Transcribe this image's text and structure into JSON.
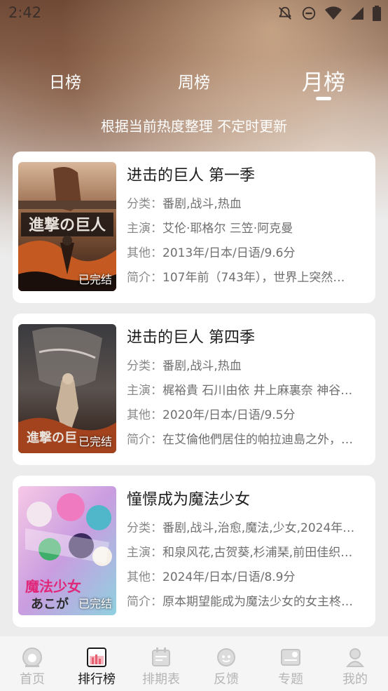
{
  "status_bar": {
    "time": "2:42"
  },
  "tabs": [
    {
      "label": "日榜",
      "active": false
    },
    {
      "label": "周榜",
      "active": false
    },
    {
      "label": "月榜",
      "active": true
    }
  ],
  "subtitle": "根据当前热度整理 不定时更新",
  "cards": [
    {
      "title": "进击的巨人 第一季",
      "category_label": "分类：",
      "category": "番剧,战斗,热血",
      "cast_label": "主演：",
      "cast": "艾伦·耶格尔 三笠·阿克曼",
      "other_label": "其他：",
      "other": "2013年/日本/日语/9.6分",
      "intro_label": "简介：",
      "intro": "107年前（743年），世界上突然…",
      "badge": "已完结"
    },
    {
      "title": "进击的巨人 第四季",
      "category_label": "分类：",
      "category": "番剧,战斗,热血",
      "cast_label": "主演：",
      "cast": "梶裕貴 石川由依 井上麻裏奈 神谷…",
      "other_label": "其他：",
      "other": "2020年/日本/日语/9.5分",
      "intro_label": "简介：",
      "intro": "在艾倫他們居住的帕拉迪島之外，…",
      "badge": "已完结"
    },
    {
      "title": "憧憬成为魔法少女",
      "category_label": "分类：",
      "category": "番剧,战斗,治愈,魔法,少女,2024年…",
      "cast_label": "主演：",
      "cast": "和泉风花,古贺葵,杉浦琹,前田佳织…",
      "other_label": "其他：",
      "other": "2024年/日本/日语/8.9分",
      "intro_label": "简介：",
      "intro": "原本期望能成为魔法少女的女主柊…",
      "badge": "已完结"
    }
  ],
  "bottom_nav": [
    {
      "label": "首页",
      "icon": "home-icon",
      "active": false
    },
    {
      "label": "排行榜",
      "icon": "ranking-icon",
      "active": true
    },
    {
      "label": "排期表",
      "icon": "calendar-icon",
      "active": false
    },
    {
      "label": "反馈",
      "icon": "feedback-icon",
      "active": false
    },
    {
      "label": "专题",
      "icon": "topic-icon",
      "active": false
    },
    {
      "label": "我的",
      "icon": "profile-icon",
      "active": false
    }
  ],
  "colors": {
    "active_nav": "#1a1a1a",
    "inactive_nav": "#b5b5b5",
    "ranking_icon_accent": "#e8606f"
  }
}
